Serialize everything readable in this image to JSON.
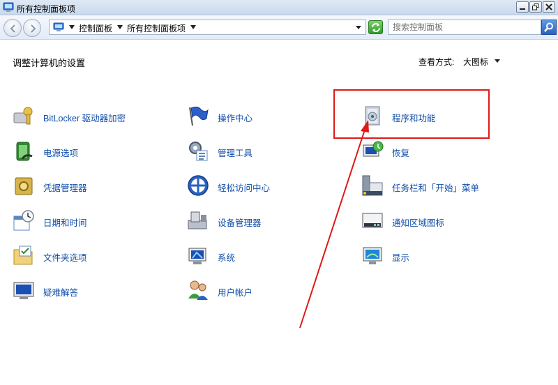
{
  "window": {
    "title": "所有控制面板项"
  },
  "address": {
    "crumbs": [
      "控制面板",
      "所有控制面板项"
    ],
    "search_placeholder": "搜索控制面板"
  },
  "header": {
    "heading": "调整计算机的设置",
    "view_by_label": "查看方式:",
    "view_by_value": "大图标"
  },
  "items": [
    {
      "label": "BitLocker 驱动器加密",
      "icon": "bitlocker-icon"
    },
    {
      "label": "操作中心",
      "icon": "action-center-flag-icon"
    },
    {
      "label": "程序和功能",
      "icon": "programs-features-icon"
    },
    {
      "label": "电源选项",
      "icon": "power-options-icon"
    },
    {
      "label": "管理工具",
      "icon": "admin-tools-icon"
    },
    {
      "label": "恢复",
      "icon": "recovery-icon"
    },
    {
      "label": "凭据管理器",
      "icon": "credential-manager-icon"
    },
    {
      "label": "轻松访问中心",
      "icon": "ease-of-access-icon"
    },
    {
      "label": "任务栏和「开始」菜单",
      "icon": "taskbar-start-icon"
    },
    {
      "label": "日期和时间",
      "icon": "date-time-icon"
    },
    {
      "label": "设备管理器",
      "icon": "device-manager-icon"
    },
    {
      "label": "通知区域图标",
      "icon": "notification-icons-icon"
    },
    {
      "label": "文件夹选项",
      "icon": "folder-options-icon"
    },
    {
      "label": "系统",
      "icon": "system-icon"
    },
    {
      "label": "显示",
      "icon": "display-icon"
    },
    {
      "label": "疑难解答",
      "icon": "troubleshooting-icon"
    },
    {
      "label": "用户帐户",
      "icon": "user-accounts-icon"
    }
  ],
  "colors": {
    "link": "#0f4da8",
    "annotation": "#e01818"
  }
}
